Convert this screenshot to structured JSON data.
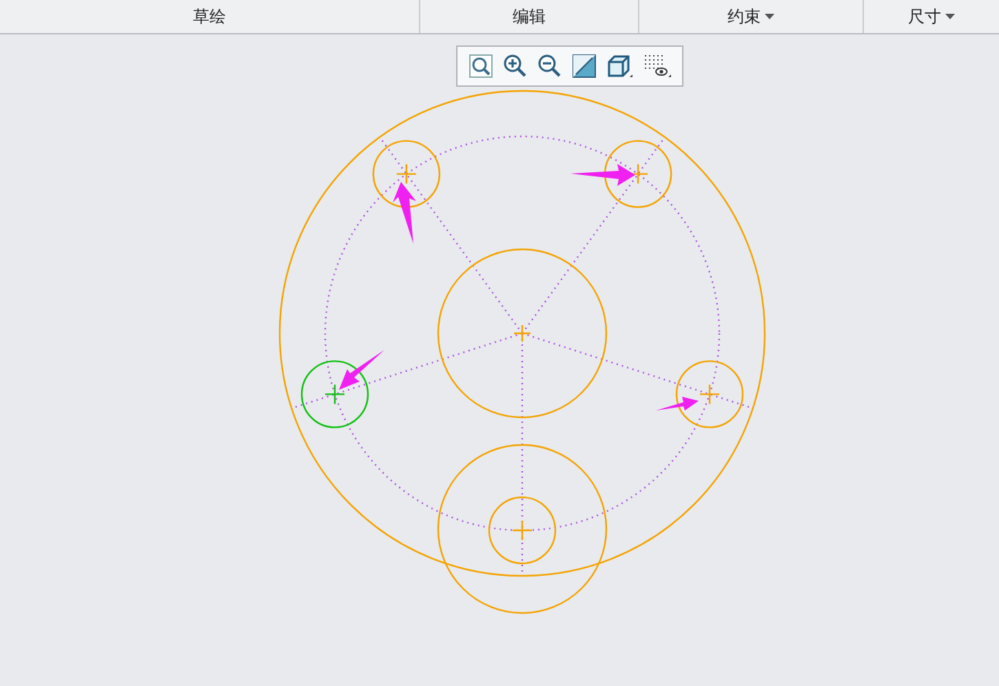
{
  "menu_tabs": [
    {
      "label": "草绘",
      "dropdown": false
    },
    {
      "label": "编辑",
      "dropdown": false
    },
    {
      "label": "约束",
      "dropdown": true
    },
    {
      "label": "尺寸",
      "dropdown": true
    }
  ],
  "toolbar": [
    {
      "kind": "refit"
    },
    {
      "kind": "zoom-in"
    },
    {
      "kind": "zoom-out"
    },
    {
      "kind": "display-style"
    },
    {
      "kind": "view"
    },
    {
      "kind": "sketch-display"
    }
  ],
  "sketch": {
    "holes": [
      {
        "selected": false
      },
      {
        "selected": false
      },
      {
        "selected": true
      },
      {
        "selected": false
      },
      {
        "selected": false
      }
    ]
  }
}
